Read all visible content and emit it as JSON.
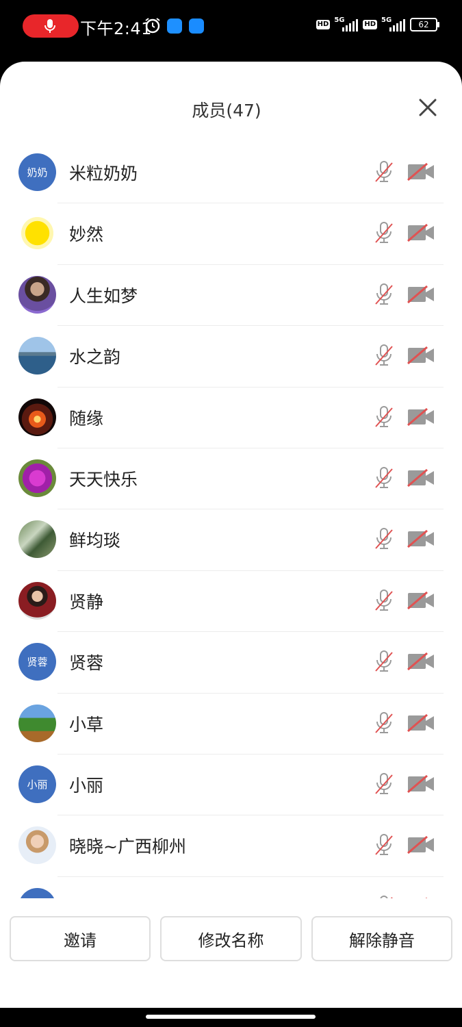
{
  "status_bar": {
    "time": "下午2:41",
    "hd_label": "HD",
    "signal_label": "5G",
    "battery": "62"
  },
  "panel": {
    "title": "成员(47)"
  },
  "members": [
    {
      "name": "米粒奶奶",
      "avatar_text": "奶奶"
    },
    {
      "name": "妙然",
      "avatar_text": ""
    },
    {
      "name": "人生如梦",
      "avatar_text": ""
    },
    {
      "name": "水之韵",
      "avatar_text": ""
    },
    {
      "name": "随缘",
      "avatar_text": ""
    },
    {
      "name": "天天快乐",
      "avatar_text": ""
    },
    {
      "name": "鲜均琰",
      "avatar_text": ""
    },
    {
      "name": "贤静",
      "avatar_text": ""
    },
    {
      "name": "贤蓉",
      "avatar_text": "贤蓉"
    },
    {
      "name": "小草",
      "avatar_text": ""
    },
    {
      "name": "小丽",
      "avatar_text": "小丽"
    },
    {
      "name": "晓晓~广西柳州",
      "avatar_text": ""
    },
    {
      "name": "",
      "avatar_text": ""
    }
  ],
  "actions": {
    "invite": "邀请",
    "rename": "修改名称",
    "unmute": "解除静音"
  },
  "colors": {
    "avatar_blue": "#3f6fbf",
    "muted_red": "#e05252",
    "icon_gray": "#9a9a9a",
    "record_red": "#e8262a"
  }
}
